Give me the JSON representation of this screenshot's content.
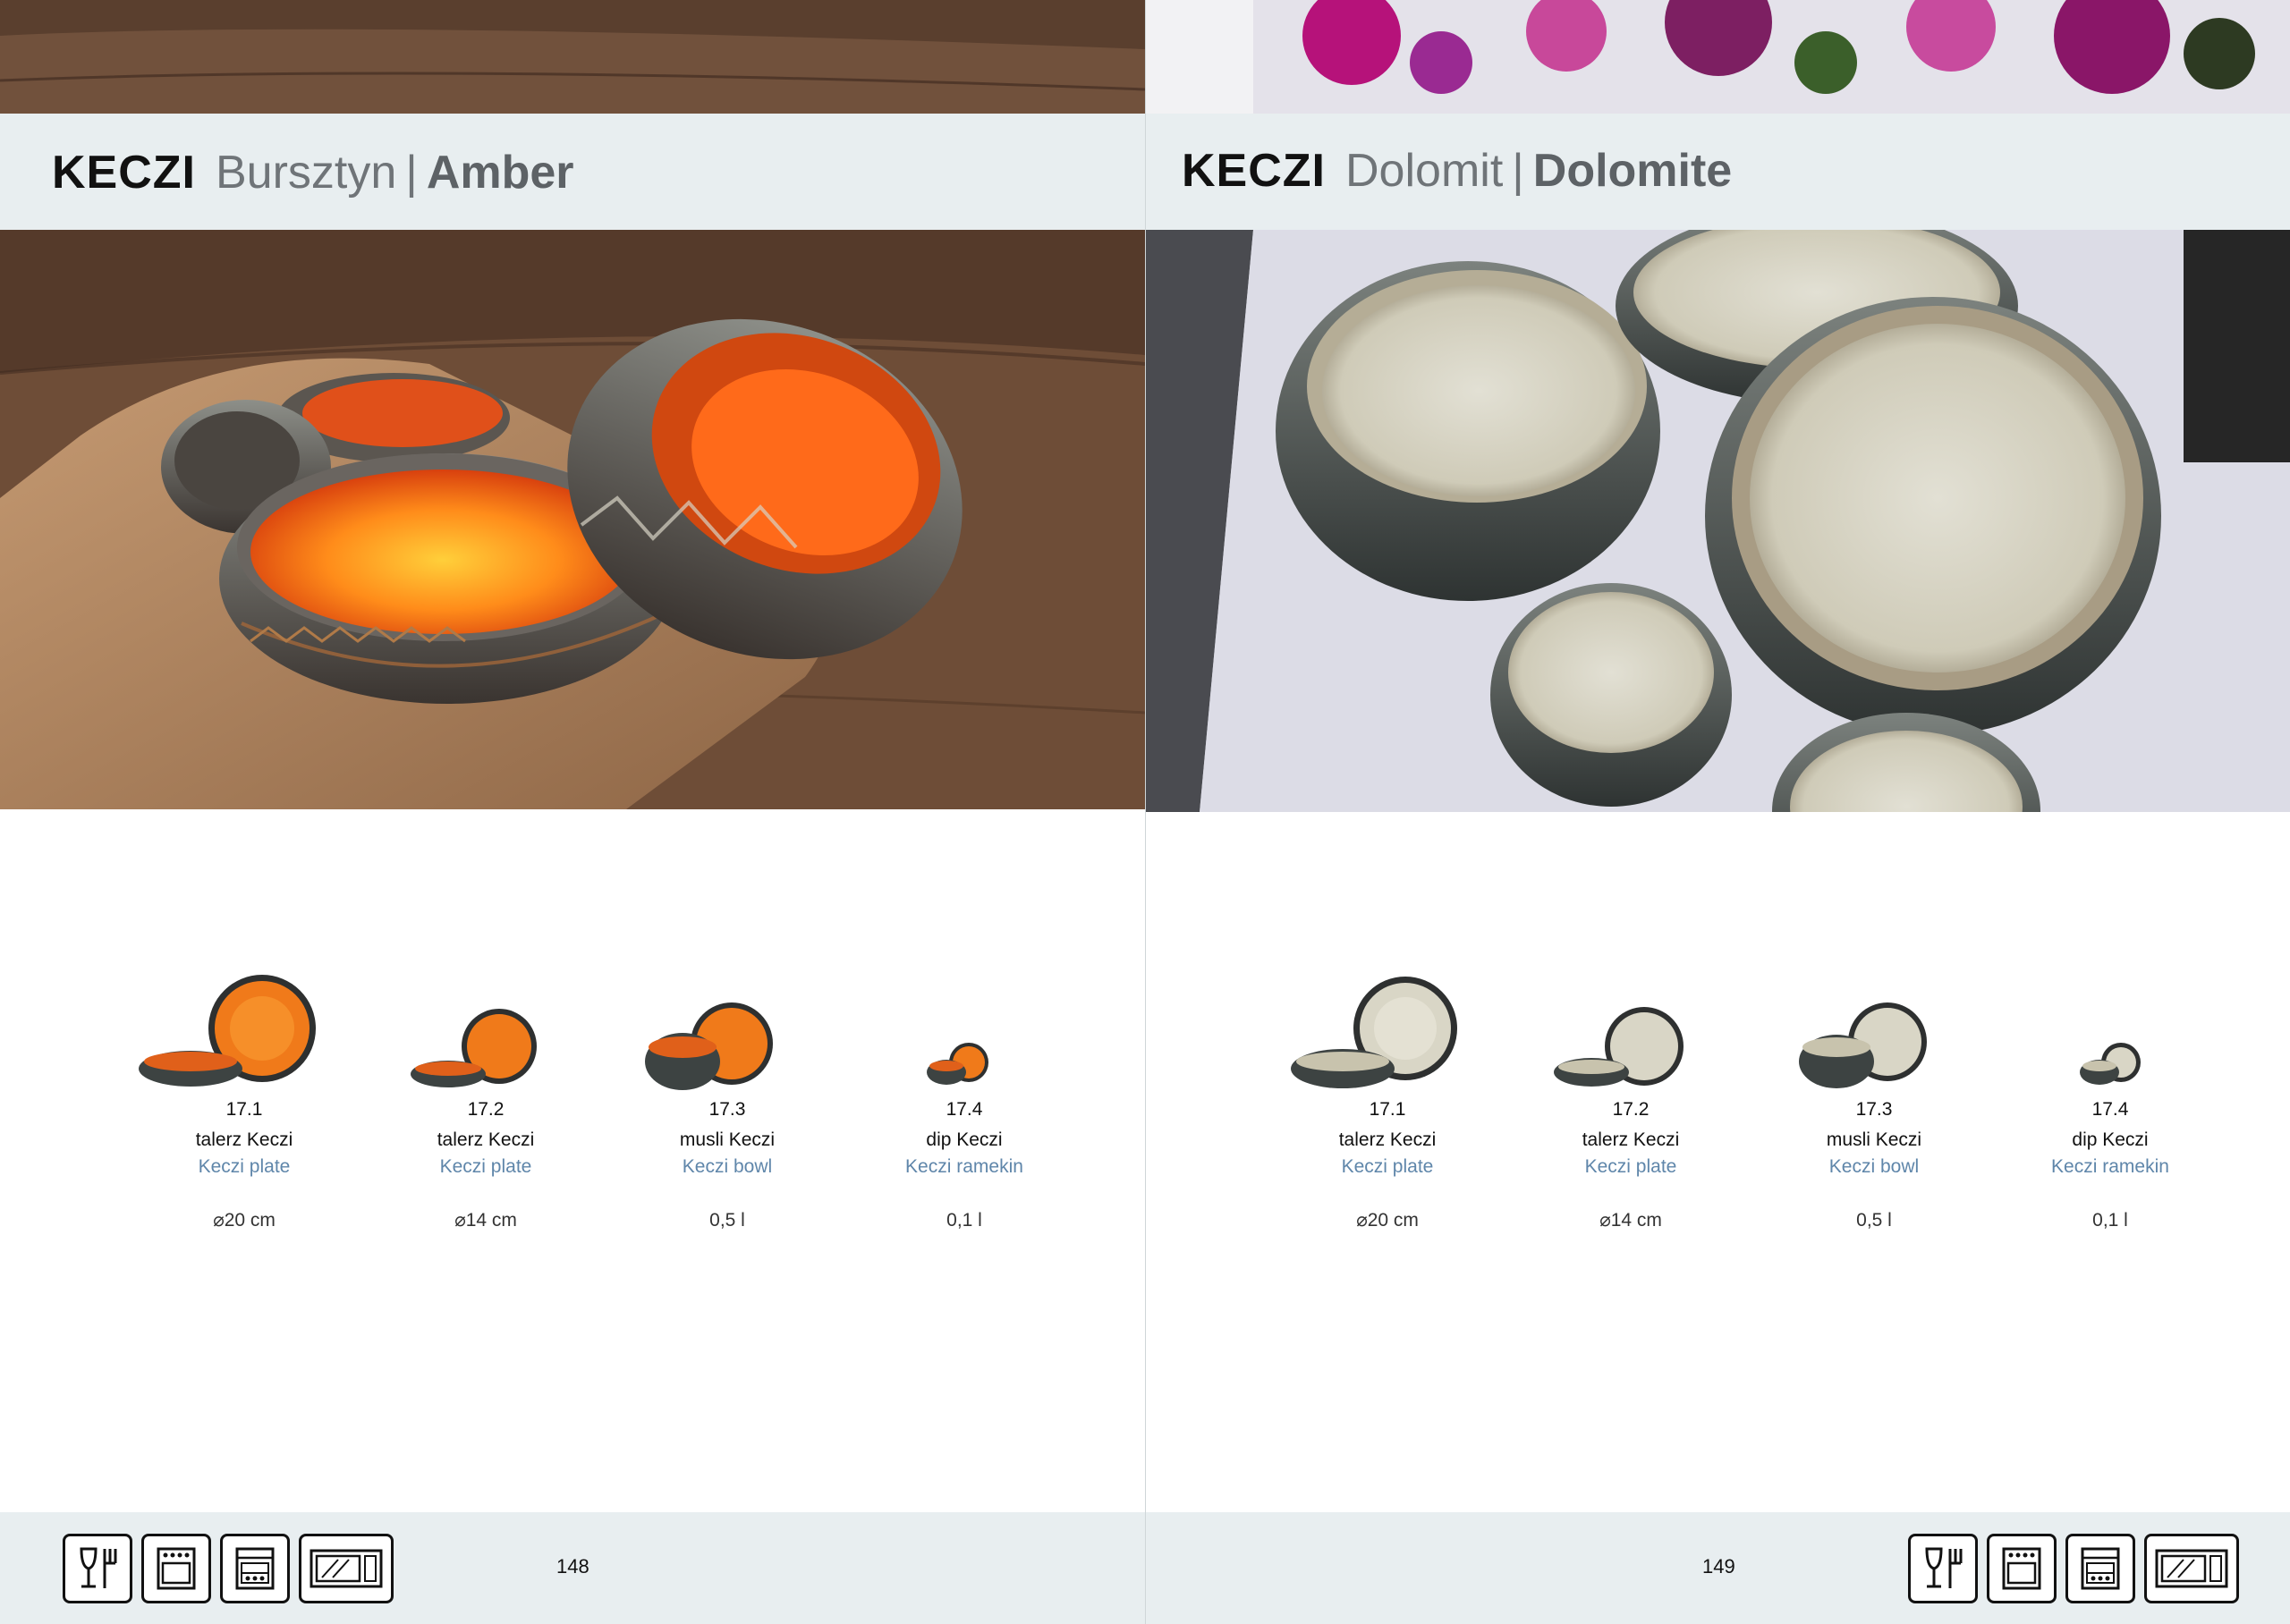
{
  "pages": [
    {
      "brand": "KECZI",
      "name_pl": "Bursztyn",
      "separator": "|",
      "name_en": "Amber",
      "page_number": "148",
      "products": [
        {
          "code": "17.1",
          "name_pl": "talerz Keczi",
          "name_en": "Keczi plate",
          "size": "⌀20 cm"
        },
        {
          "code": "17.2",
          "name_pl": "talerz Keczi",
          "name_en": "Keczi plate",
          "size": "⌀14 cm"
        },
        {
          "code": "17.3",
          "name_pl": "musli Keczi",
          "name_en": "Keczi bowl",
          "size": "0,5 l"
        },
        {
          "code": "17.4",
          "name_pl": "dip Keczi",
          "name_en": "Keczi ramekin",
          "size": "0,1 l"
        }
      ]
    },
    {
      "brand": "KECZI",
      "name_pl": "Dolomit",
      "separator": "|",
      "name_en": "Dolomite",
      "page_number": "149",
      "products": [
        {
          "code": "17.1",
          "name_pl": "talerz Keczi",
          "name_en": "Keczi plate",
          "size": "⌀20 cm"
        },
        {
          "code": "17.2",
          "name_pl": "talerz Keczi",
          "name_en": "Keczi plate",
          "size": "⌀14 cm"
        },
        {
          "code": "17.3",
          "name_pl": "musli Keczi",
          "name_en": "Keczi bowl",
          "size": "0,5 l"
        },
        {
          "code": "17.4",
          "name_pl": "dip Keczi",
          "name_en": "Keczi ramekin",
          "size": "0,1 l"
        }
      ]
    }
  ],
  "usage_icons": [
    "food-safe-icon",
    "oven-icon",
    "dishwasher-icon",
    "microwave-icon"
  ],
  "colors": {
    "band_background": "#e8eef0",
    "english_label": "#5f86aa",
    "amber_glaze": "#f07a1a",
    "dolomite_glaze": "#d9d6c6",
    "rim": "#3d4342"
  }
}
